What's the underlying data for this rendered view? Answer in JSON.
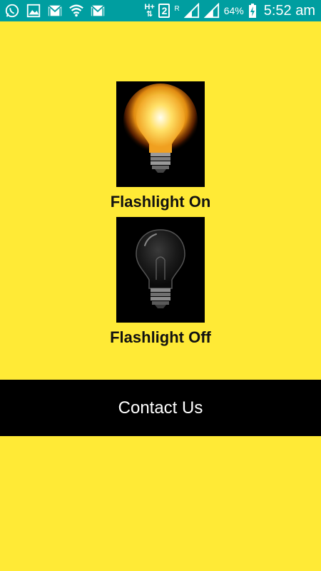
{
  "status_bar": {
    "network_type": "H+",
    "sim_slot": "2",
    "roaming": "R",
    "battery_percent": "64%",
    "time": "5:52 am",
    "icons": [
      "whatsapp-icon",
      "gallery-icon",
      "gmail-icon",
      "wifi-icon",
      "gmail-icon",
      "signal-icon",
      "battery-charging-icon"
    ]
  },
  "main": {
    "on_label": "Flashlight On",
    "off_label": "Flashlight Off",
    "contact_label": "Contact Us"
  },
  "colors": {
    "background": "#ffea36",
    "status_bar": "#009ea0",
    "contact_bar": "#000000"
  }
}
